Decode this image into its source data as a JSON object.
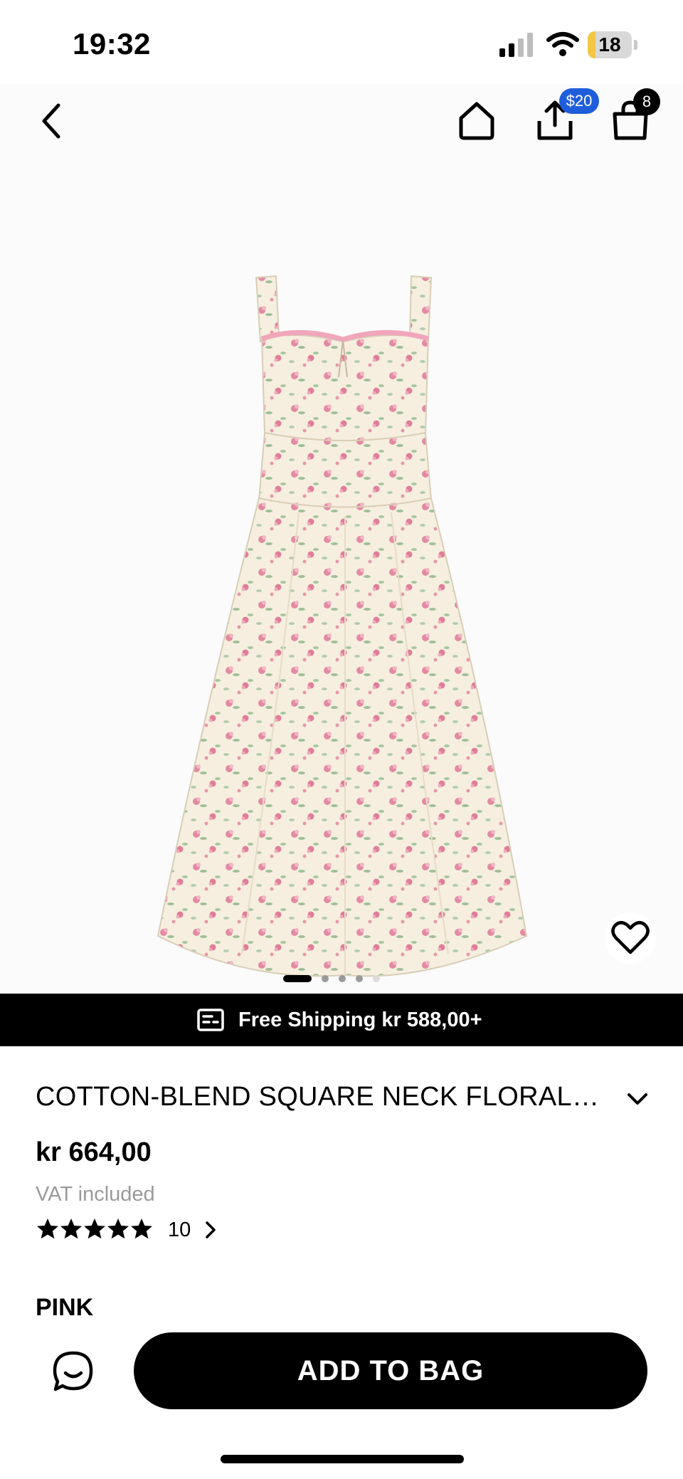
{
  "status_bar": {
    "time": "19:32",
    "battery": "18",
    "battery_level": 0.18
  },
  "nav": {
    "share_badge": "$20",
    "bag_count": "8"
  },
  "gallery": {
    "image_count": 5,
    "active_index": 0
  },
  "shipping_banner": {
    "text": "Free Shipping kr 588,00+"
  },
  "product": {
    "title": "COTTON-BLEND SQUARE NECK FLORAL…",
    "price": "kr 664,00",
    "vat_note": "VAT included",
    "rating_stars": 5,
    "review_count": "10",
    "color": "PINK"
  },
  "actions": {
    "add_to_bag": "ADD TO BAG"
  },
  "colors": {
    "share_badge": "#1f5edb",
    "banner_bg": "#000000",
    "battery_fill": "#f2c744",
    "vat_text": "#9a9a9a"
  },
  "icons": {
    "back": "chevron-left-icon",
    "home": "home-icon",
    "share": "share-icon",
    "bag": "shopping-bag-icon",
    "wishlist": "heart-icon",
    "shipping": "shipping-icon",
    "expand": "chevron-down-icon",
    "review_arrow": "chevron-right-icon",
    "chat": "chat-icon"
  }
}
